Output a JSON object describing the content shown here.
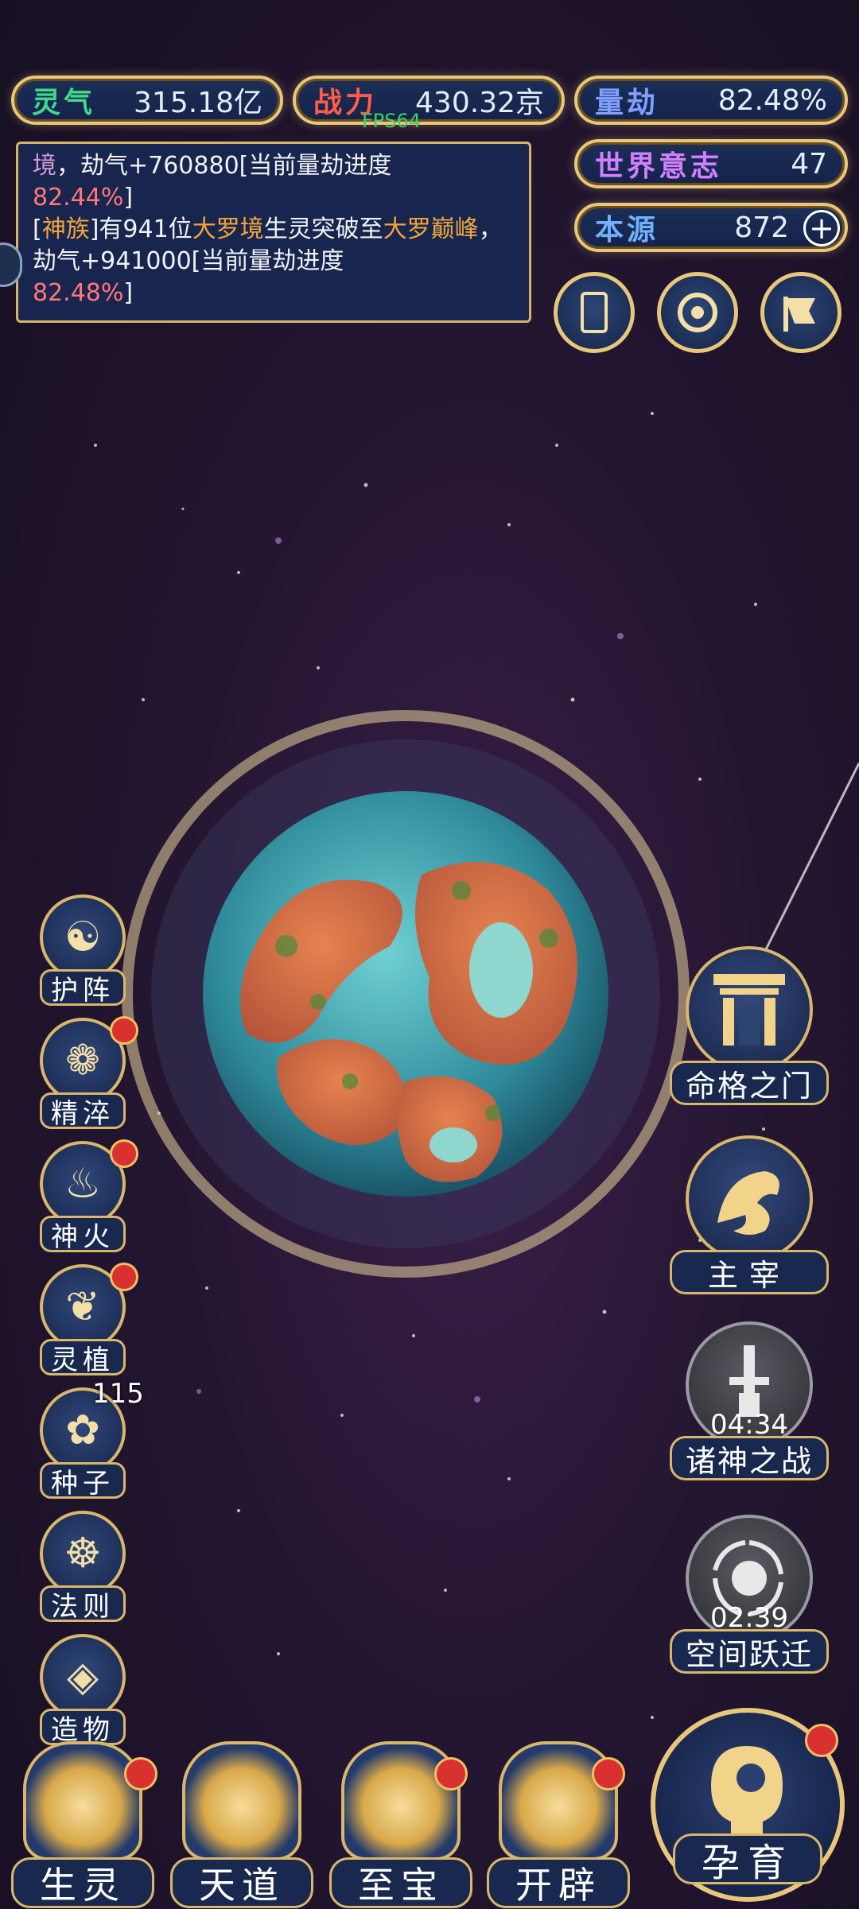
{
  "stats": {
    "lingqi": {
      "label": "灵气",
      "value": "315.18亿",
      "color": "#3fd98a"
    },
    "zhanli": {
      "label": "战力",
      "value": "430.32京",
      "color": "#ff5c4a"
    },
    "liangjie": {
      "label": "量劫",
      "value": "82.48%",
      "color": "#7fa0ff"
    },
    "shijieyizhi": {
      "label": "世界意志",
      "value": "47",
      "color": "#d080ff"
    },
    "benyuan": {
      "label": "本源",
      "value": "872",
      "color": "#6fb0ff"
    }
  },
  "fps": "FPS64",
  "log": {
    "line1_prefix": "境",
    "line1_text": "，劫气+760880[当前量劫进度",
    "line1_pct": "82.44%",
    "line1_end": "]",
    "line2_open": "[",
    "line2_race": "神族",
    "line2_text1": "]有941位",
    "line2_realm1": "大罗境",
    "line2_text2": "生灵突破至",
    "line2_realm2": "大罗巅峰",
    "line2_text3": "，劫气+941000[当前量劫进度",
    "line2_pct": "82.48%",
    "line2_end": "]"
  },
  "tools": [
    "card-icon",
    "vortex-icon",
    "flag-icon"
  ],
  "left_menu": [
    {
      "label": "护阵",
      "icon": "☯",
      "badge": false
    },
    {
      "label": "精淬",
      "icon": "❁",
      "badge": true
    },
    {
      "label": "神火",
      "icon": "♨",
      "badge": true
    },
    {
      "label": "灵植",
      "icon": "❦",
      "badge": true
    },
    {
      "label": "种子",
      "icon": "✿",
      "badge": false,
      "count": "115"
    },
    {
      "label": "法则",
      "icon": "☸",
      "badge": false
    },
    {
      "label": "造物",
      "icon": "◈",
      "badge": false
    }
  ],
  "right_menu": [
    {
      "label": "命格之门",
      "timer": ""
    },
    {
      "label": "主宰",
      "timer": ""
    },
    {
      "label": "诸神之战",
      "timer": "04:34"
    },
    {
      "label": "空间跃迁",
      "timer": "02:39"
    }
  ],
  "bottom_nav": [
    {
      "label": "生灵",
      "badge": true
    },
    {
      "label": "天道",
      "badge": false
    },
    {
      "label": "至宝",
      "badge": true
    },
    {
      "label": "开辟",
      "badge": true
    }
  ],
  "main_button": {
    "label": "孕育",
    "badge": true
  }
}
